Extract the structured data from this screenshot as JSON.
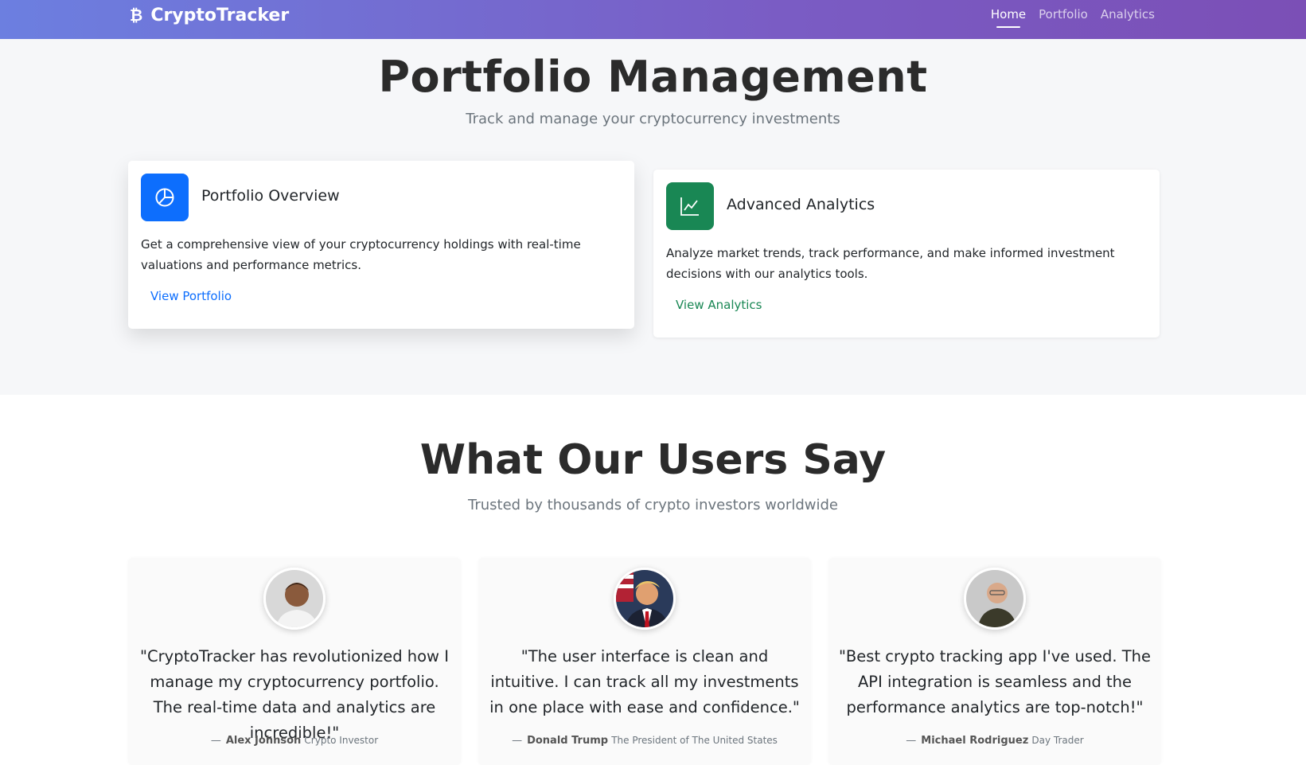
{
  "navbar": {
    "brand_icon": "bitcoin-icon",
    "brand_symbol": "₿",
    "brand": "CryptoTracker",
    "links": [
      {
        "label": "Home",
        "active": true
      },
      {
        "label": "Portfolio",
        "active": false
      },
      {
        "label": "Analytics",
        "active": false
      }
    ]
  },
  "hero": {
    "title": "Portfolio Management",
    "subtitle": "Track and manage your cryptocurrency investments"
  },
  "cards": [
    {
      "icon": "pie-chart-icon",
      "title": "Portfolio Overview",
      "text": "Get a comprehensive view of your cryptocurrency holdings with real-time valuations and performance metrics.",
      "link": "View Portfolio",
      "color": "#0d6efd"
    },
    {
      "icon": "line-chart-icon",
      "title": "Advanced Analytics",
      "text": "Analyze market trends, track performance, and make informed investment decisions with our analytics tools.",
      "link": "View Analytics",
      "color": "#198754"
    }
  ],
  "testimonials": {
    "title": "What Our Users Say",
    "subtitle": "Trusted by thousands of crypto investors worldwide",
    "items": [
      {
        "quote": "\"CryptoTracker has revolutionized how I manage my cryptocurrency portfolio. The real-time data and analytics are incredible!\"",
        "name": "Alex Johnson",
        "role": "Crypto Investor"
      },
      {
        "quote": "\"The user interface is clean and intuitive. I can track all my investments in one place with ease and confidence.\"",
        "name": "Donald Trump",
        "role": "The President of The United States"
      },
      {
        "quote": "\"Best crypto tracking app I've used. The API integration is seamless and the performance analytics are top-notch!\"",
        "name": "Michael Rodriguez",
        "role": "Day Trader"
      }
    ]
  }
}
